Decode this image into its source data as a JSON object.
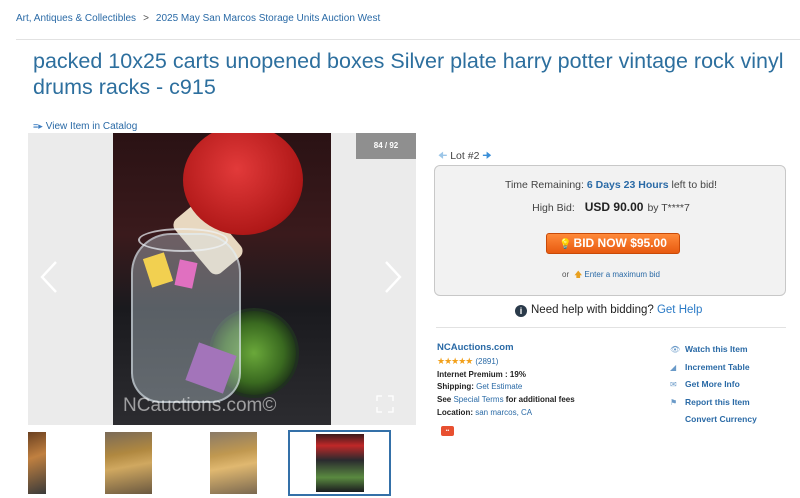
{
  "breadcrumb": {
    "category": "Art, Antiques & Collectibles",
    "separator": ">",
    "auction": "2025 May San Marcos Storage Units Auction West"
  },
  "title": "packed 10x25 carts unopened boxes Silver plate harry potter vintage rock vinyl drums racks - c915",
  "catalog_link": "View Item in Catalog",
  "viewer": {
    "counter": "84 / 92",
    "watermark": "NCauctions.com©"
  },
  "lot": {
    "label": "Lot #2"
  },
  "bid_box": {
    "time_label": "Time Remaining:",
    "time_value": "6 Days 23 Hours",
    "time_suffix": "left to bid!",
    "high_bid_label": "High Bid:",
    "high_bid_value": "USD 90.00",
    "high_bid_by": "by T****7",
    "bid_button": "BID NOW $95.00",
    "max_or": "or",
    "max_link": "Enter a maximum bid"
  },
  "help": {
    "text": "Need help with bidding?",
    "link": "Get Help"
  },
  "seller": {
    "name": "NCAuctions.com",
    "rating_stars": 5,
    "rating_count": "(2891)",
    "premium_label": "Internet Premium :",
    "premium_value": "19%",
    "shipping_label": "Shipping:",
    "shipping_link": "Get Estimate",
    "terms_see": "See",
    "terms_link": "Special Terms",
    "terms_suffix": "for additional fees",
    "location_label": "Location:",
    "location_value": "san marcos, CA"
  },
  "actions": [
    {
      "icon": "eye-icon",
      "label": "Watch this Item"
    },
    {
      "icon": "increment-icon",
      "label": "Increment Table"
    },
    {
      "icon": "mail-icon",
      "label": "Get More Info"
    },
    {
      "icon": "flag-icon",
      "label": "Report this Item"
    },
    {
      "icon": "",
      "label": "Convert Currency"
    }
  ],
  "colors": {
    "title": "#2d6f9e",
    "link": "#2a6aa6",
    "bid_button": "#e85a10",
    "stars": "#f2a01a"
  }
}
